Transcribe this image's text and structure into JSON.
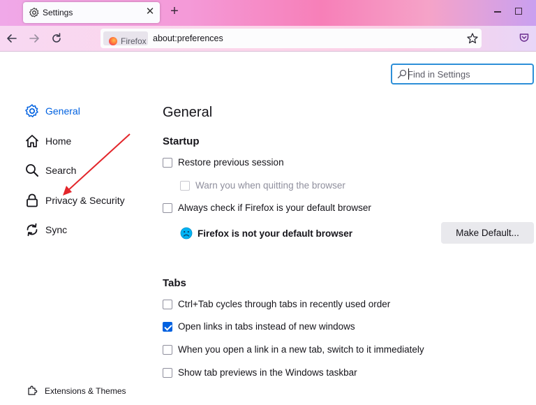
{
  "browser": {
    "tab_title": "Settings",
    "tab_close": "✕",
    "new_tab": "+",
    "identity_label": "Firefox",
    "url": "about:preferences"
  },
  "search": {
    "placeholder": "Find in Settings"
  },
  "sidebar": {
    "items": [
      {
        "label": "General",
        "icon": "gear-icon",
        "selected": true
      },
      {
        "label": "Home",
        "icon": "home-icon"
      },
      {
        "label": "Search",
        "icon": "search-icon"
      },
      {
        "label": "Privacy & Security",
        "icon": "lock-icon"
      },
      {
        "label": "Sync",
        "icon": "sync-icon"
      }
    ],
    "extensions_label": "Extensions & Themes"
  },
  "main": {
    "title": "General",
    "startup": {
      "heading": "Startup",
      "restore_session": "Restore previous session",
      "warn_quitting": "Warn you when quitting the browser",
      "always_check_default": "Always check if Firefox is your default browser",
      "not_default_text": "Firefox is not your default browser",
      "make_default_button": "Make Default..."
    },
    "tabs": {
      "heading": "Tabs",
      "options": [
        {
          "label": "Ctrl+Tab cycles through tabs in recently used order",
          "checked": false
        },
        {
          "label": "Open links in tabs instead of new windows",
          "checked": true
        },
        {
          "label": "When you open a link in a new tab, switch to it immediately",
          "checked": false
        },
        {
          "label": "Show tab previews in the Windows taskbar",
          "checked": false
        }
      ]
    }
  },
  "colors": {
    "accent": "#0061e0",
    "annotation_arrow": "#e3262b"
  }
}
